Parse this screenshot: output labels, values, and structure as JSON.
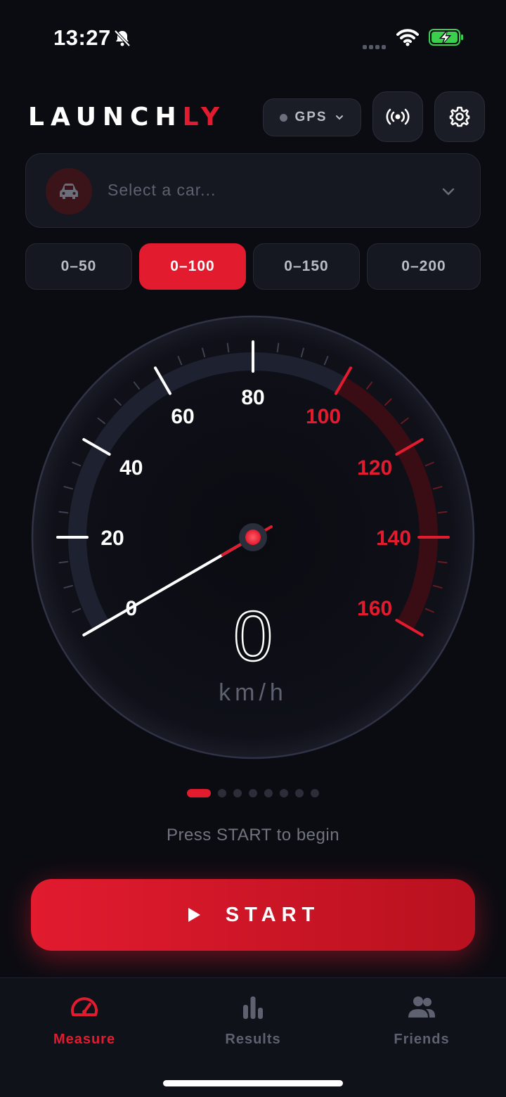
{
  "status_bar": {
    "time": "13:27"
  },
  "header": {
    "logo_main": "LAUNCH",
    "logo_accent": "LY",
    "gps_label": "GPS"
  },
  "car_select": {
    "placeholder": "Select a car..."
  },
  "ranges": [
    {
      "label": "0–50",
      "active": false
    },
    {
      "label": "0–100",
      "active": true
    },
    {
      "label": "0–150",
      "active": false
    },
    {
      "label": "0–200",
      "active": false
    }
  ],
  "gauge": {
    "speed": "0",
    "unit": "km/h",
    "min": 0,
    "max": 160,
    "redline_from": 100,
    "labels": [
      "0",
      "20",
      "40",
      "60",
      "80",
      "100",
      "120",
      "140",
      "160"
    ],
    "accent_color": "#e21b2f"
  },
  "pager": {
    "count": 8,
    "active_index": 0
  },
  "hint": "Press START to begin",
  "start_button": {
    "label": "START"
  },
  "bottom_nav": [
    {
      "label": "Measure",
      "icon": "speedometer-icon",
      "active": true
    },
    {
      "label": "Results",
      "icon": "bar-chart-icon",
      "active": false
    },
    {
      "label": "Friends",
      "icon": "people-icon",
      "active": false
    }
  ]
}
